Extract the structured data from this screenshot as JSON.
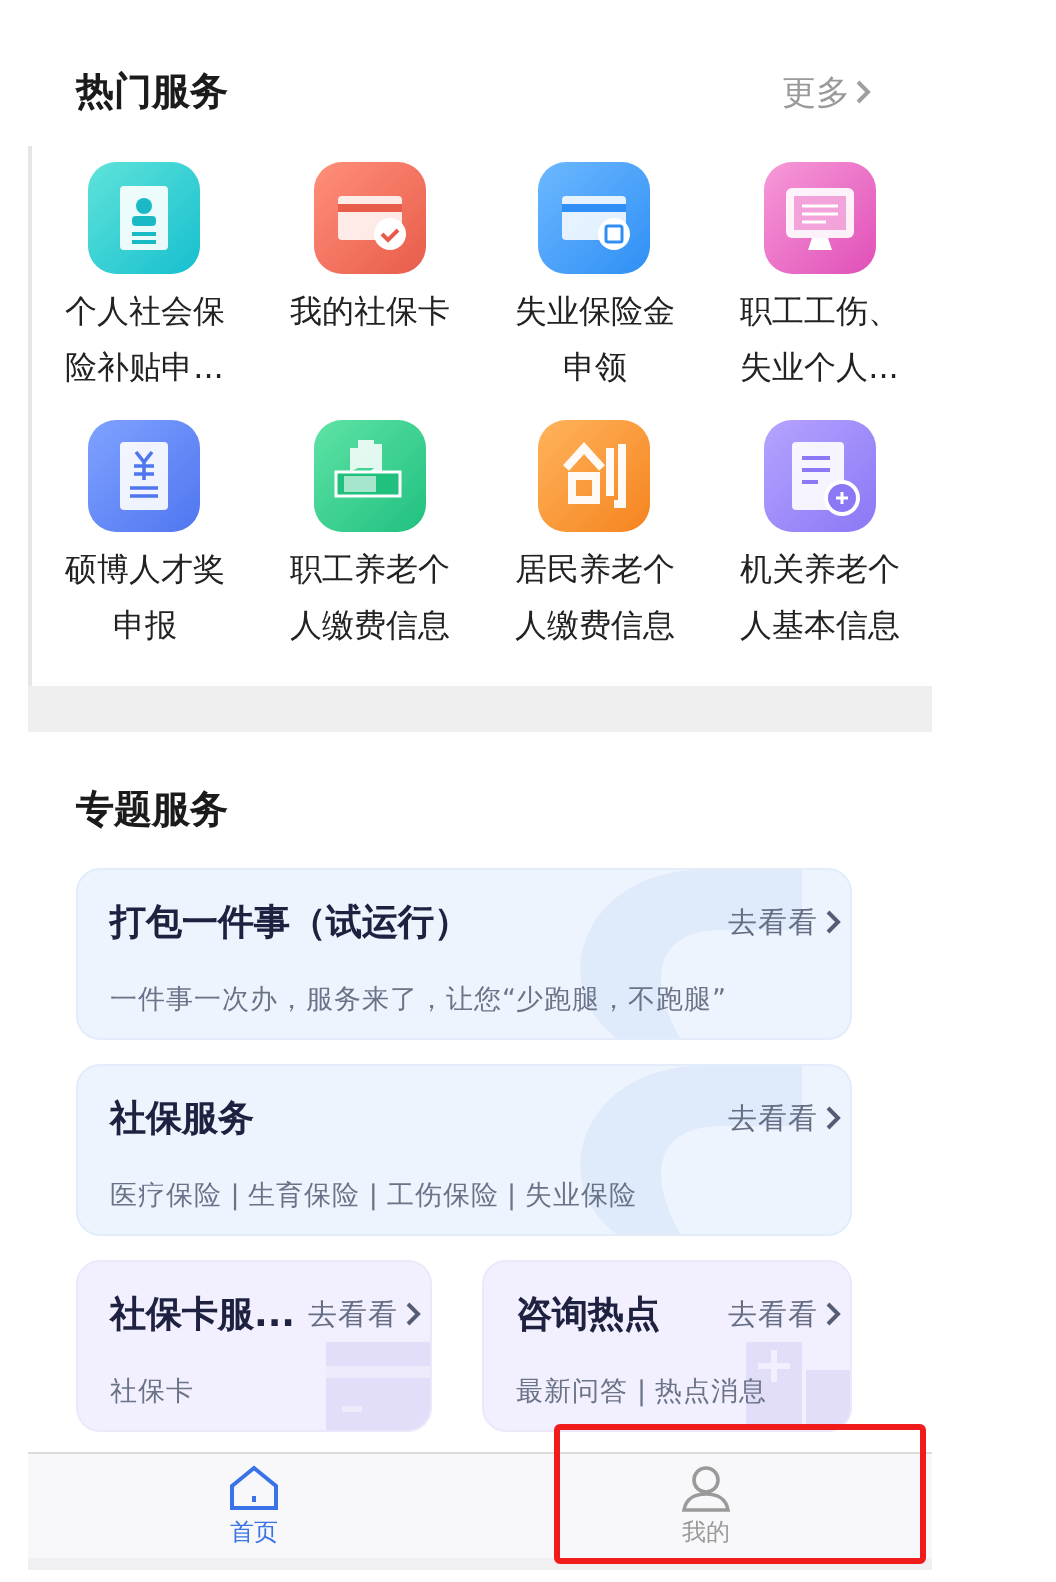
{
  "hot_services": {
    "title": "热门服务",
    "more": "更多",
    "items": [
      {
        "label": "个人社会保险补贴申...",
        "kind": "person-doc"
      },
      {
        "label": "我的社保卡",
        "kind": "card-check"
      },
      {
        "label": "失业保险金申领",
        "kind": "card-edit"
      },
      {
        "label": "职工工伤、失业个人...",
        "kind": "monitor"
      },
      {
        "label": "硕博人才奖申报",
        "kind": "yuan-doc"
      },
      {
        "label": "职工养老个人缴费信息",
        "kind": "hand"
      },
      {
        "label": "居民养老个人缴费信息",
        "kind": "chuang"
      },
      {
        "label": "机关养老个人基本信息",
        "kind": "bao-doc"
      }
    ]
  },
  "topic_services": {
    "title": "专题服务",
    "wide_cards": [
      {
        "title": "打包一件事（试运行）",
        "link": "去看看",
        "subtitle": "一件事一次办，服务来了，让您“少跑腿，不跑腿”"
      },
      {
        "title": "社保服务",
        "link": "去看看",
        "subtitle": "医疗保险 | 生育保险 | 工伤保险 | 失业保险"
      }
    ],
    "small_cards": [
      {
        "title": "社保卡服...",
        "link": "去看看",
        "subtitle": "社保卡",
        "kind": "card"
      },
      {
        "title": "咨询热点",
        "link": "去看看",
        "subtitle": "最新问答 | 热点消息",
        "kind": "building"
      }
    ]
  },
  "tab_bar": [
    {
      "label": "首页",
      "kind": "home",
      "selected": true
    },
    {
      "label": "我的",
      "kind": "person",
      "selected": false
    }
  ]
}
